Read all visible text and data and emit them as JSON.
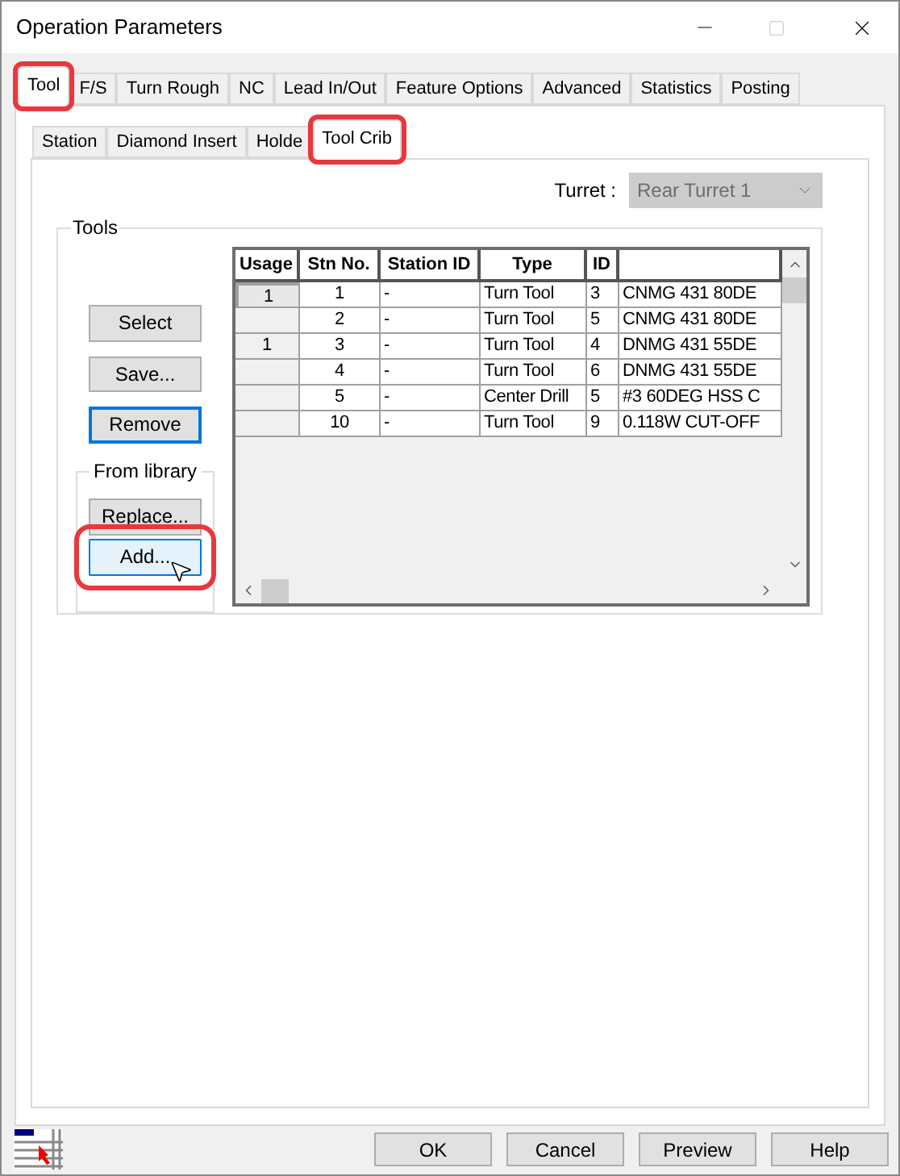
{
  "window": {
    "title": "Operation Parameters"
  },
  "tabs": [
    {
      "label": "Tool",
      "selected": true,
      "highlighted": true
    },
    {
      "label": "F/S",
      "selected": false,
      "highlighted": false
    },
    {
      "label": "Turn Rough",
      "selected": false,
      "highlighted": false
    },
    {
      "label": "NC",
      "selected": false,
      "highlighted": false
    },
    {
      "label": "Lead In/Out",
      "selected": false,
      "highlighted": false
    },
    {
      "label": "Feature Options",
      "selected": false,
      "highlighted": false
    },
    {
      "label": "Advanced",
      "selected": false,
      "highlighted": false
    },
    {
      "label": "Statistics",
      "selected": false,
      "highlighted": false
    },
    {
      "label": "Posting",
      "selected": false,
      "highlighted": false
    }
  ],
  "subtabs": [
    {
      "label": "Station",
      "selected": false,
      "highlighted": false
    },
    {
      "label": "Diamond Insert",
      "selected": false,
      "highlighted": false
    },
    {
      "label": "Holde",
      "selected": false,
      "highlighted": false
    },
    {
      "label": "Tool Crib",
      "selected": true,
      "highlighted": true
    }
  ],
  "turret": {
    "label": "Turret :",
    "value": "Rear Turret 1",
    "disabled": true
  },
  "tools_group": {
    "title": "Tools",
    "buttons": [
      {
        "label": "Select",
        "focused": false
      },
      {
        "label": "Save...",
        "focused": false
      },
      {
        "label": "Remove",
        "focused": true
      }
    ],
    "library_group": {
      "title": "From library",
      "buttons": [
        {
          "label": "Replace...",
          "hovered": false,
          "highlighted": false
        },
        {
          "label": "Add...",
          "hovered": true,
          "highlighted": true
        }
      ]
    }
  },
  "table": {
    "columns": [
      "Usage",
      "Stn No.",
      "Station ID",
      "Type",
      "ID",
      ""
    ],
    "rows": [
      {
        "selected": true,
        "cells": [
          "1",
          "1",
          "-",
          "Turn Tool",
          "3",
          "CNMG 431 80DE"
        ]
      },
      {
        "selected": false,
        "cells": [
          "",
          "2",
          "-",
          "Turn Tool",
          "5",
          "CNMG 431 80DE"
        ]
      },
      {
        "selected": false,
        "cells": [
          "1",
          "3",
          "-",
          "Turn Tool",
          "4",
          "DNMG 431 55DE"
        ]
      },
      {
        "selected": false,
        "cells": [
          "",
          "4",
          "-",
          "Turn Tool",
          "6",
          "DNMG 431 55DE"
        ]
      },
      {
        "selected": false,
        "cells": [
          "",
          "5",
          "-",
          "Center Drill",
          "5",
          "#3 60DEG HSS C"
        ]
      },
      {
        "selected": false,
        "cells": [
          "",
          "10",
          "-",
          "Turn Tool",
          "9",
          "0.118W CUT-OFF"
        ]
      }
    ]
  },
  "footer_buttons": [
    "OK",
    "Cancel",
    "Preview",
    "Help"
  ]
}
